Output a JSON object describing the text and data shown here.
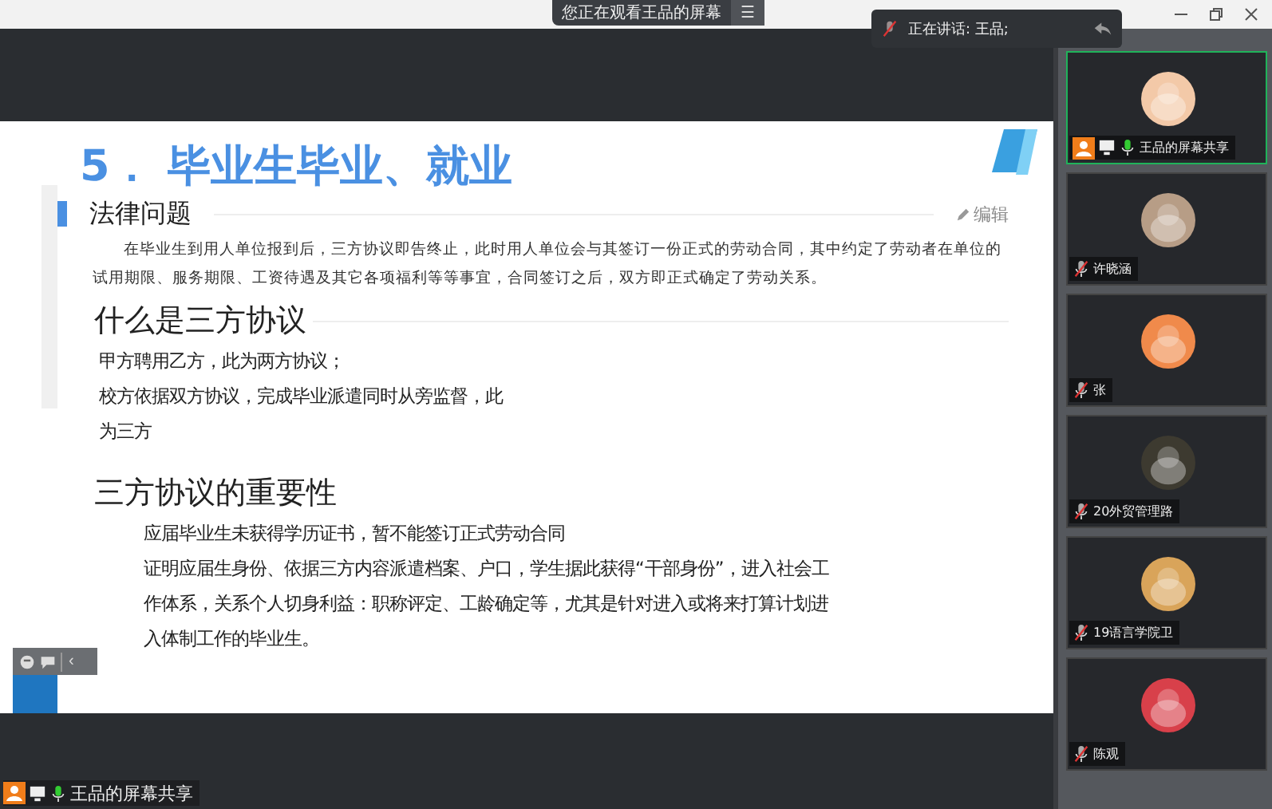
{
  "top_bar": {
    "viewing_label": "您正在观看王品的屏幕",
    "menu_glyph": "☰",
    "speaking_label": "正在讲话: 王品;"
  },
  "slide": {
    "title": "5． 毕业生毕业、就业",
    "section": "法律问题",
    "edit_link": "编辑",
    "paragraph": "在毕业生到用人单位报到后，三方协议即告终止，此时用人单位会与其签订一份正式的劳动合同，其中约定了劳动者在单位的试用期限、服务期限、工资待遇及其它各项福利等等事宜，合同签订之后，双方即正式确定了劳动关系。",
    "blocks": [
      {
        "heading": "什么是三方协议",
        "indent": false,
        "lines": [
          "甲方聘用乙方，此为两方协议；",
          "校方依据双方协议，完成毕业派遣同时从旁监督，此",
          "为三方"
        ]
      },
      {
        "heading": "三方协议的重要性",
        "indent": true,
        "lines": [
          "应届毕业生未获得学历证书，暂不能签订正式劳动合同",
          "证明应届生身份、依据三方内容派遣档案、户口，学生据此获得“干部身份”，进入社会工",
          "作体系，关系个人切身利益：职称评定、工龄确定等，尤其是针对进入或将来打算计划进",
          "入体制工作的毕业生。"
        ]
      }
    ]
  },
  "collapse_glyph": "‹",
  "participants": [
    {
      "name": "王品的屏幕共享",
      "host": true,
      "sharing": true,
      "muted": false,
      "selected": true,
      "color": "#f3c9a8"
    },
    {
      "name": "许晓涵",
      "host": false,
      "sharing": false,
      "muted": true,
      "selected": false,
      "color": "#b79d86"
    },
    {
      "name": "张",
      "host": false,
      "sharing": false,
      "muted": true,
      "selected": false,
      "color": "#f08a4b"
    },
    {
      "name": "20外贸管理路",
      "host": false,
      "sharing": false,
      "muted": true,
      "selected": false,
      "color": "#3d3a30"
    },
    {
      "name": "19语言学院卫",
      "host": false,
      "sharing": false,
      "muted": true,
      "selected": false,
      "color": "#d9a45a"
    },
    {
      "name": "陈观",
      "host": false,
      "sharing": false,
      "muted": true,
      "selected": false,
      "color": "#d8404a"
    }
  ],
  "bottom_label": {
    "name": "王品的屏幕共享",
    "host": true,
    "sharing": true,
    "muted": false
  }
}
